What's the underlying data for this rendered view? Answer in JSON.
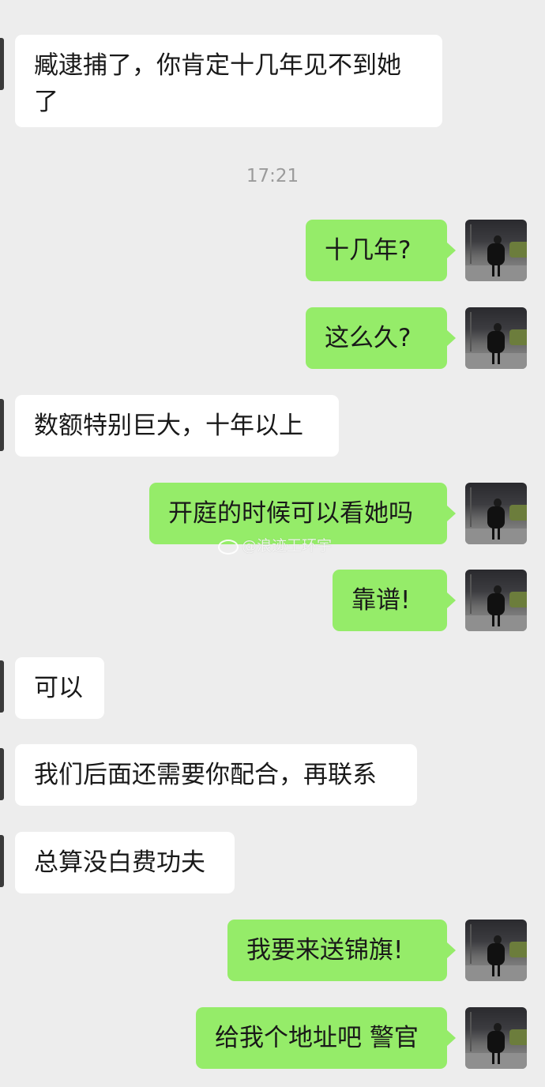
{
  "chat": {
    "timestamp": "17:21",
    "messages": [
      {
        "side": "left",
        "text": "臧逮捕了，你肯定十几年见不到她\n了"
      },
      {
        "side": "right",
        "text": "十几年?"
      },
      {
        "side": "right",
        "text": "这么久?"
      },
      {
        "side": "left",
        "text": "数额特别巨大，十年以上"
      },
      {
        "side": "right",
        "text": "开庭的时候可以看她吗"
      },
      {
        "side": "right",
        "text": "靠谱!"
      },
      {
        "side": "left",
        "text": "可以"
      },
      {
        "side": "left",
        "text": "我们后面还需要你配合，再联系"
      },
      {
        "side": "left",
        "text": "总算没白费功夫"
      },
      {
        "side": "right",
        "text": "我要来送锦旗!"
      },
      {
        "side": "right",
        "text": "给我个地址吧 警官"
      }
    ]
  },
  "watermark": {
    "text": "@浪迹王环宇"
  },
  "icons": {
    "watermark_logo": "weibo-icon",
    "avatar": "user-avatar-photo"
  },
  "colors": {
    "background": "#ededed",
    "sent_bubble": "#95ec69",
    "received_bubble": "#ffffff"
  }
}
